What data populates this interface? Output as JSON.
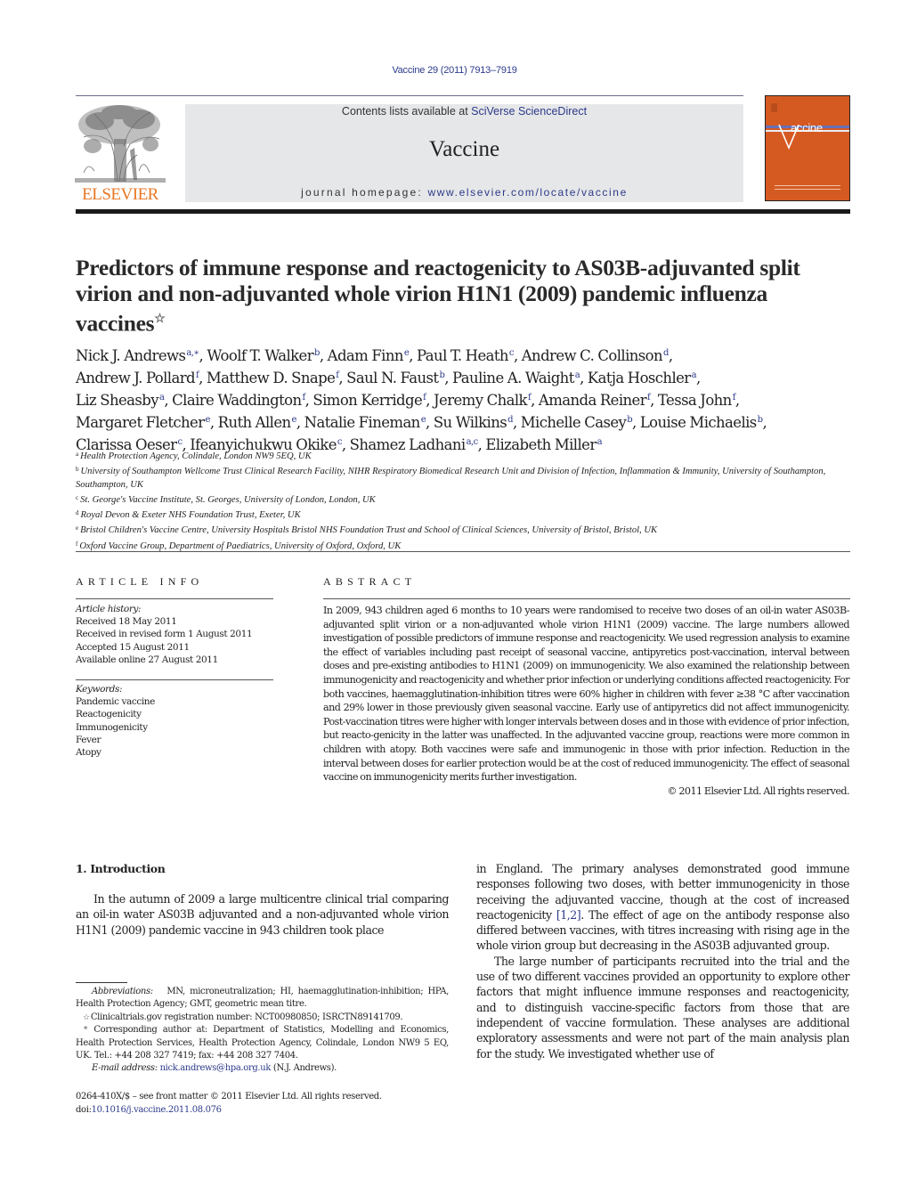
{
  "masthead": {
    "citation": "Vaccine 29 (2011) 7913–7919",
    "publisher_logo_text": "ELSEVIER",
    "contents_prefix": "Contents lists available at ",
    "contents_link": "SciVerse ScienceDirect",
    "journal_name": "Vaccine",
    "homepage_prefix": "journal homepage: ",
    "homepage_link": "www.elsevier.com/locate/vaccine",
    "cover_title": "accine",
    "colors": {
      "link": "#2c3a8a",
      "elsevier_orange": "#e87722",
      "cover_orange": "#d55a22",
      "band_gray": "#e6e7e8"
    }
  },
  "article": {
    "title": "Predictors of immune response and reactogenicity to AS03B-adjuvanted split virion and non-adjuvanted whole virion H1N1 (2009) pandemic influenza vaccines",
    "title_mark": "☆",
    "authors": [
      {
        "name": "Nick J. Andrews",
        "aff": "a,∗"
      },
      {
        "name": "Woolf T. Walker",
        "aff": "b"
      },
      {
        "name": "Adam Finn",
        "aff": "e"
      },
      {
        "name": "Paul T. Heath",
        "aff": "c"
      },
      {
        "name": "Andrew C. Collinson",
        "aff": "d"
      },
      {
        "name": "Andrew J. Pollard",
        "aff": "f"
      },
      {
        "name": "Matthew D. Snape",
        "aff": "f"
      },
      {
        "name": "Saul N. Faust",
        "aff": "b"
      },
      {
        "name": "Pauline A. Waight",
        "aff": "a"
      },
      {
        "name": "Katja Hoschler",
        "aff": "a"
      },
      {
        "name": "Liz Sheasby",
        "aff": "a"
      },
      {
        "name": "Claire Waddington",
        "aff": "f"
      },
      {
        "name": "Simon Kerridge",
        "aff": "f"
      },
      {
        "name": "Jeremy Chalk",
        "aff": "f"
      },
      {
        "name": "Amanda Reiner",
        "aff": "f"
      },
      {
        "name": "Tessa John",
        "aff": "f"
      },
      {
        "name": "Margaret Fletcher",
        "aff": "e"
      },
      {
        "name": "Ruth Allen",
        "aff": "e"
      },
      {
        "name": "Natalie Fineman",
        "aff": "e"
      },
      {
        "name": "Su Wilkins",
        "aff": "d"
      },
      {
        "name": "Michelle Casey",
        "aff": "b"
      },
      {
        "name": "Louise Michaelis",
        "aff": "b"
      },
      {
        "name": "Clarissa Oeser",
        "aff": "c"
      },
      {
        "name": "Ifeanyichukwu Okike",
        "aff": "c"
      },
      {
        "name": "Shamez Ladhani",
        "aff": "a,c"
      },
      {
        "name": "Elizabeth Miller",
        "aff": "a"
      }
    ],
    "affiliations": [
      {
        "key": "a",
        "text": "Health Protection Agency, Colindale, London NW9 5EQ, UK"
      },
      {
        "key": "b",
        "text": "University of Southampton Wellcome Trust Clinical Research Facility, NIHR Respiratory Biomedical Research Unit and Division of Infection, Inflammation & Immunity, University of Southampton, Southampton, UK"
      },
      {
        "key": "c",
        "text": "St. George's Vaccine Institute, St. Georges, University of London, London, UK"
      },
      {
        "key": "d",
        "text": "Royal Devon & Exeter NHS Foundation Trust, Exeter, UK"
      },
      {
        "key": "e",
        "text": "Bristol Children's Vaccine Centre, University Hospitals Bristol NHS Foundation Trust and School of Clinical Sciences, University of Bristol, Bristol, UK"
      },
      {
        "key": "f",
        "text": "Oxford Vaccine Group, Department of Paediatrics, University of Oxford, Oxford, UK"
      }
    ]
  },
  "article_info": {
    "heading": "ARTICLE INFO",
    "history_label": "Article history:",
    "history": [
      "Received 18 May 2011",
      "Received in revised form 1 August 2011",
      "Accepted 15 August 2011",
      "Available online 27 August 2011"
    ],
    "keywords_label": "Keywords:",
    "keywords": [
      "Pandemic vaccine",
      "Reactogenicity",
      "Immunogenicity",
      "Fever",
      "Atopy"
    ]
  },
  "abstract": {
    "heading": "ABSTRACT",
    "text": "In 2009, 943 children aged 6 months to 10 years were randomised to receive two doses of an oil-in water AS03B-adjuvanted split virion or a non-adjuvanted whole virion H1N1 (2009) vaccine. The large numbers allowed investigation of possible predictors of immune response and reactogenicity. We used regression analysis to examine the effect of variables including past receipt of seasonal vaccine, antipyretics post-vaccination, interval between doses and pre-existing antibodies to H1N1 (2009) on immunogenicity. We also examined the relationship between immunogenicity and reactogenicity and whether prior infection or underlying conditions affected reactogenicity. For both vaccines, haemagglutination-inhibition titres were 60% higher in children with fever ≥38 °C after vaccination and 29% lower in those previously given seasonal vaccine. Early use of antipyretics did not affect immunogenicity. Post-vaccination titres were higher with longer intervals between doses and in those with evidence of prior infection, but reacto-genicity in the latter was unaffected. In the adjuvanted vaccine group, reactions were more common in children with atopy. Both vaccines were safe and immunogenic in those with prior infection. Reduction in the interval between doses for earlier protection would be at the cost of reduced immunogenicity. The effect of seasonal vaccine on immunogenicity merits further investigation.",
    "copyright": "© 2011 Elsevier Ltd. All rights reserved."
  },
  "introduction": {
    "heading": "1.  Introduction",
    "left_para": "In the autumn of 2009 a large multicentre clinical trial comparing an oil-in water AS03B adjuvanted and a non-adjuvanted whole virion H1N1 (2009) pandemic vaccine in 943 children took place",
    "right_para1_before_ref": "in England. The primary analyses demonstrated good immune responses following two doses, with better immunogenicity in those receiving the adjuvanted vaccine, though at the cost of increased reactogenicity ",
    "right_para1_ref": "[1,2]",
    "right_para1_after_ref": ". The effect of age on the antibody response also differed between vaccines, with titres increasing with rising age in the whole virion group but decreasing in the AS03B adjuvanted group.",
    "right_para2": "The large number of participants recruited into the trial and the use of two different vaccines provided an opportunity to explore other factors that might influence immune responses and reactogenicity, and to distinguish vaccine-specific factors from those that are independent of vaccine formulation. These analyses are additional exploratory assessments and were not part of the main analysis plan for the study. We investigated whether use of"
  },
  "footnotes": {
    "abbrev_label": "Abbreviations:",
    "abbrev_text": "MN, microneutralization; HI, haemagglutination-inhibition; HPA, Health Protection Agency; GMT, geometric mean titre.",
    "star_mark": "☆",
    "star_text": "Clinicaltrials.gov registration number: NCT00980850; ISRCTN89141709.",
    "corr_mark": "*",
    "corr_text": "Corresponding author at: Department of Statistics, Modelling and Economics, Health Protection Services, Health Protection Agency, Colindale, London NW9 5 EQ, UK. Tel.: +44 208 327 7419; fax: +44 208 327 7404.",
    "email_label": "E-mail address:",
    "email": "nick.andrews@hpa.org.uk",
    "email_suffix": " (N.J. Andrews)."
  },
  "front_matter": {
    "issn_line": "0264-410X/$ – see front matter © 2011 Elsevier Ltd. All rights reserved.",
    "doi_prefix": "doi:",
    "doi": "10.1016/j.vaccine.2011.08.076"
  }
}
